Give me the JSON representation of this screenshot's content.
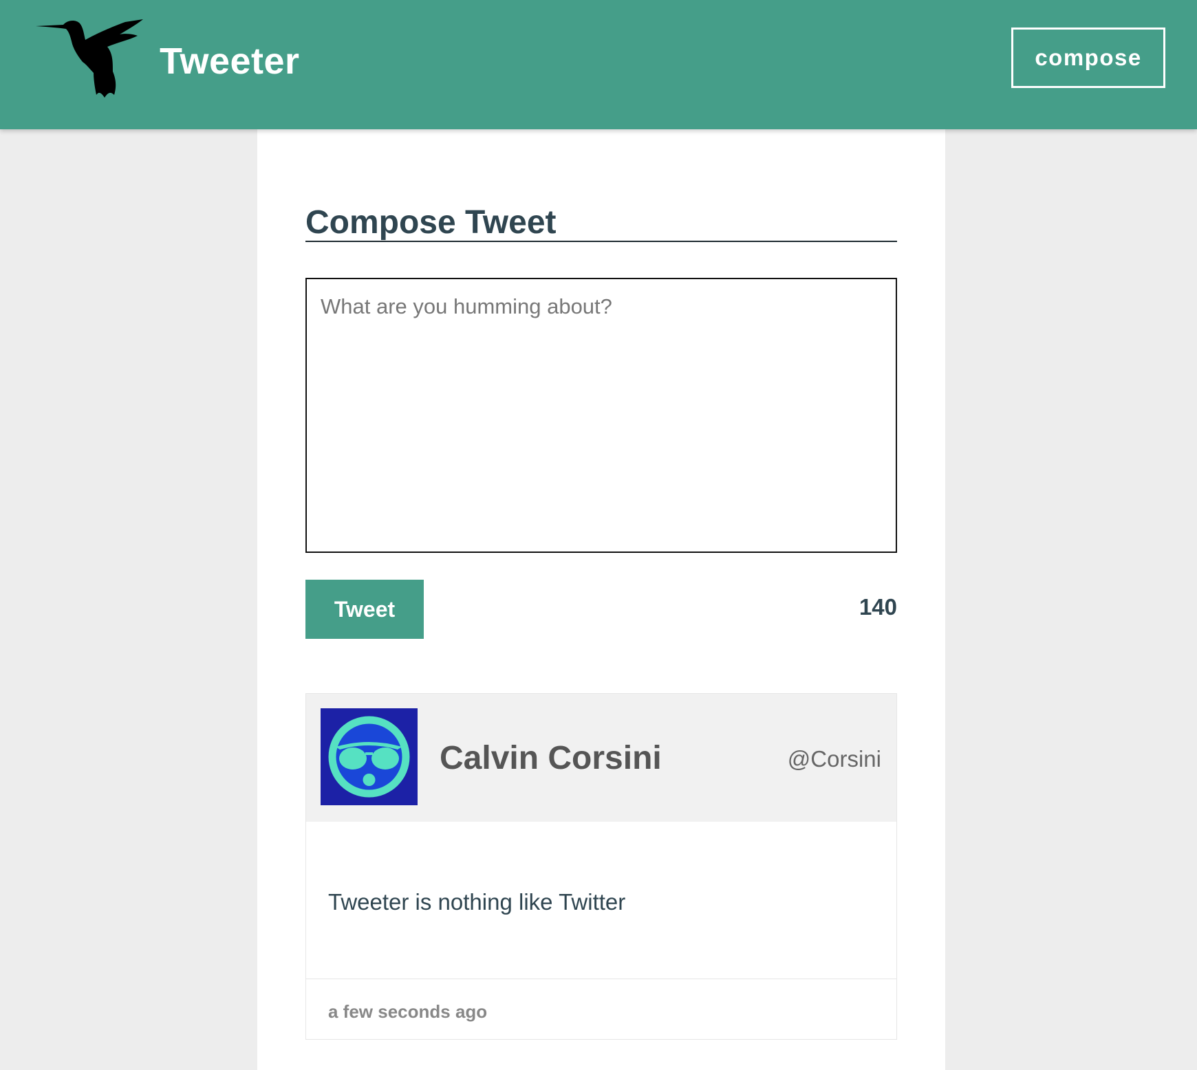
{
  "header": {
    "brand": "Tweeter",
    "compose_label": "compose",
    "logo_icon": "hummingbird-icon",
    "bg_color": "#459e89"
  },
  "composer": {
    "title": "Compose Tweet",
    "placeholder": "What are you humming about?",
    "tweet_button_label": "Tweet",
    "char_counter": "140"
  },
  "tweets": [
    {
      "name": "Calvin Corsini",
      "handle": "@Corsini",
      "avatar_icon": "sunglasses-face-icon",
      "text": "Tweeter is nothing like Twitter",
      "time": "a few seconds ago"
    }
  ]
}
